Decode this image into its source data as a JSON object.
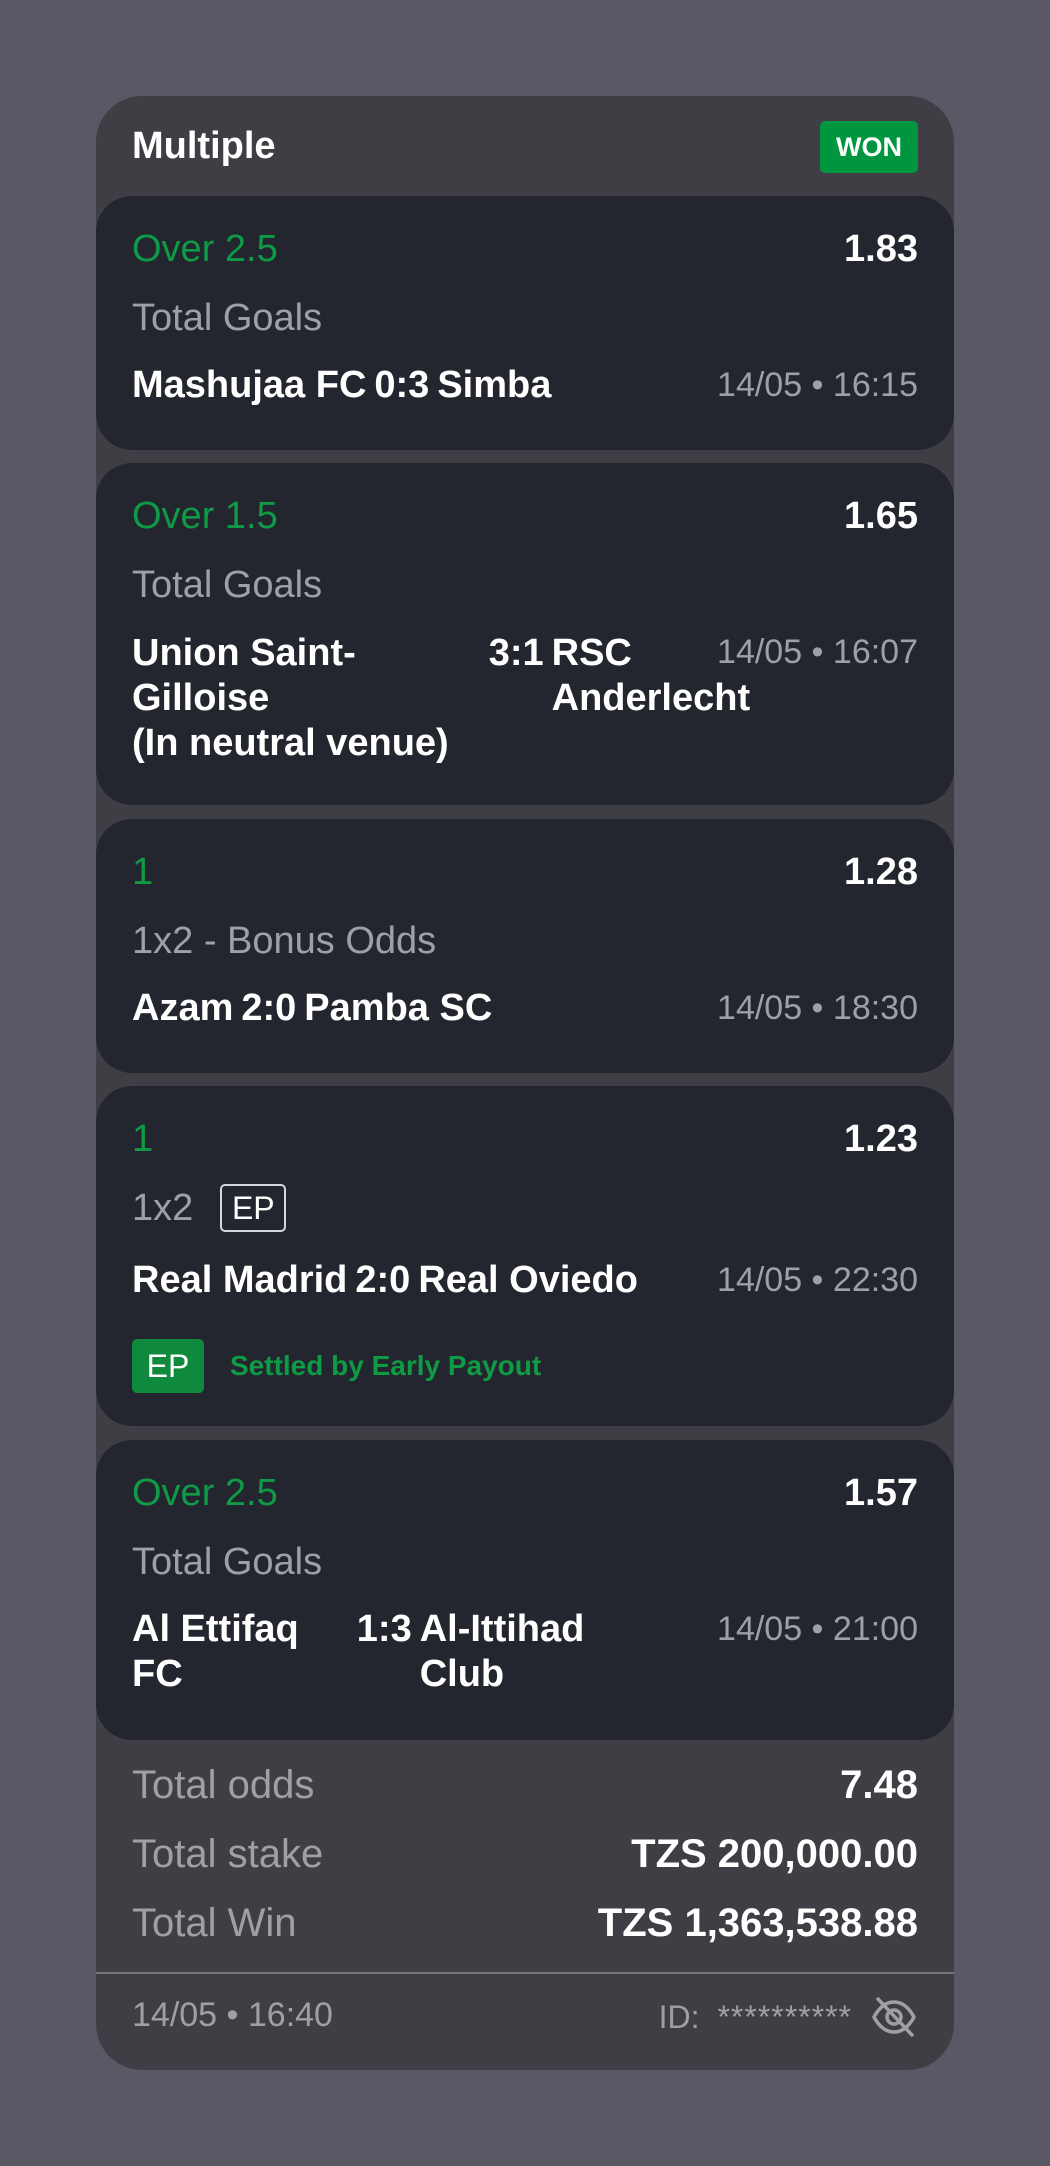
{
  "slip": {
    "title": "Multiple",
    "status": "WON",
    "legs": [
      {
        "pick": "Over 2.5",
        "odd": "1.83",
        "market": "Total Goals",
        "home": "Mashujaa FC",
        "score": "0:3",
        "away": "Simba",
        "kickoff": "14/05 • 16:15"
      },
      {
        "pick": "Over 1.5",
        "odd": "1.65",
        "market": "Total Goals",
        "home": "Union Saint-\nGilloise\n(In neutral venue)",
        "score": "3:1",
        "away": "RSC\nAnderlecht",
        "kickoff": "14/05 • 16:07"
      },
      {
        "pick": "1",
        "odd": "1.28",
        "market": "1x2 - Bonus Odds",
        "home": "Azam",
        "score": "2:0",
        "away": "Pamba SC",
        "kickoff": "14/05 • 18:30"
      },
      {
        "pick": "1",
        "odd": "1.23",
        "market": "1x2",
        "market_badge": "EP",
        "home": "Real Madrid",
        "score": "2:0",
        "away": "Real Oviedo",
        "kickoff": "14/05 • 22:30",
        "ep_badge": "EP",
        "ep_note": "Settled by Early Payout"
      },
      {
        "pick": "Over 2.5",
        "odd": "1.57",
        "market": "Total Goals",
        "home": "Al Ettifaq\nFC",
        "score": "1:3",
        "away": "Al-Ittihad\nClub",
        "kickoff": "14/05 • 21:00"
      }
    ],
    "totals": {
      "odds_label": "Total odds",
      "odds_value": "7.48",
      "stake_label": "Total stake",
      "stake_value": "TZS 200,000.00",
      "win_label": "Total Win",
      "win_value": "TZS 1,363,538.88"
    },
    "footer": {
      "date": "14/05 • 16:40",
      "id_label": "ID:",
      "id_value": "**********",
      "visibility_icon": "eye-off-icon"
    }
  },
  "colors": {
    "page_bg": "#5a5864",
    "card_bg": "#403e45",
    "leg_bg": "#23262f",
    "accent_green": "#0f9a45",
    "won_badge": "#00963f",
    "muted_text": "#9fa0a6"
  }
}
